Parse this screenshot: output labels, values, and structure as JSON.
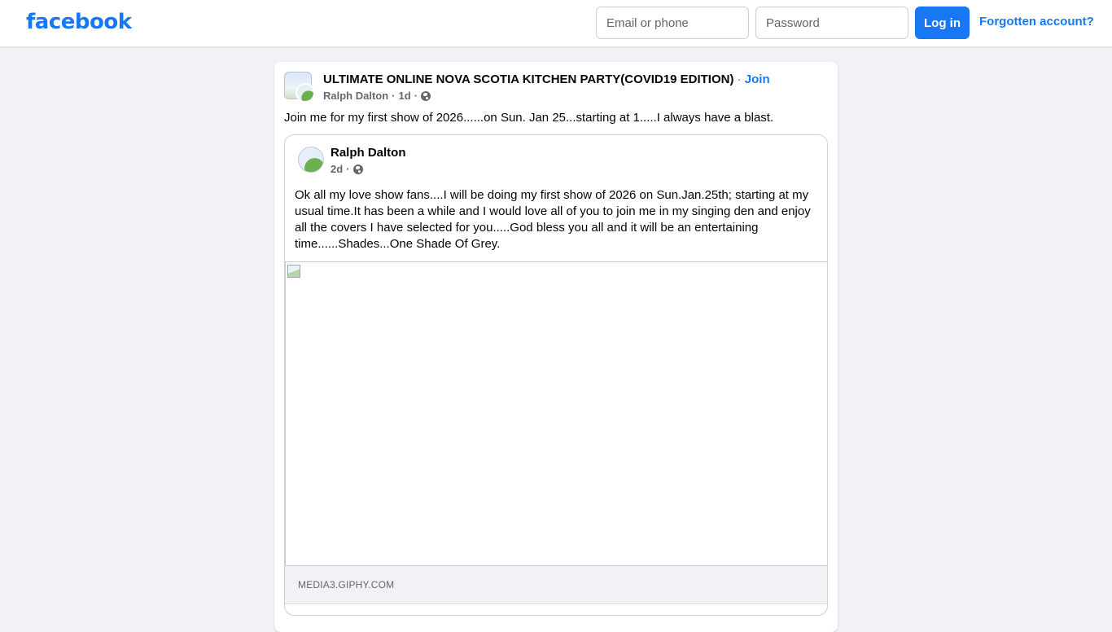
{
  "header": {
    "logo": "facebook",
    "email_placeholder": "Email or phone",
    "password_placeholder": "Password",
    "login_label": "Log in",
    "forgot_label": "Forgotten account?"
  },
  "post": {
    "group_name": "ULTIMATE ONLINE NOVA SCOTIA KITCHEN PARTY(COVID19 EDITION)",
    "separator": "·",
    "join_label": "Join",
    "author": "Ralph Dalton",
    "time": "1d",
    "audience_icon": "globe-icon",
    "text": "Join me for my first show of 2026......on Sun. Jan 25...starting at 1.....I always have a blast."
  },
  "shared_post": {
    "author": "Ralph Dalton",
    "time": "2d",
    "audience_icon": "globe-icon",
    "text": "Ok all my love show fans....I will be doing my first show of 2026 on Sun.Jan.25th; starting at my usual time.It has been a while and I would love all of you to join me in my singing den and enjoy all the covers I have selected for you.....God bless you all and it will be an entertaining time......Shades...One Shade Of Grey.",
    "link_domain": "MEDIA3.GIPHY.COM"
  },
  "colors": {
    "brand": "#1877f2",
    "background": "#f0f2f5",
    "secondary_text": "#65676b"
  }
}
